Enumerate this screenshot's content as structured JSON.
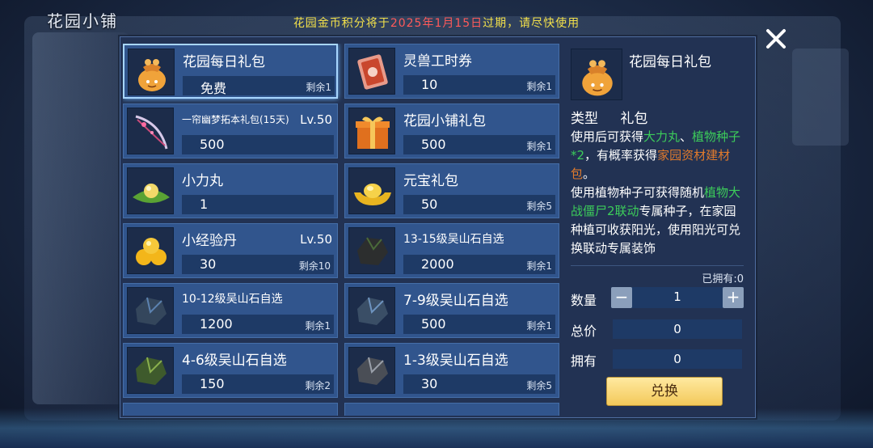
{
  "header": {
    "title": "花园小铺",
    "notice_prefix": "花园金币积分将于",
    "notice_date": "2025年1月15日",
    "notice_suffix": "过期，请尽快使用"
  },
  "items": [
    {
      "name": "花园每日礼包",
      "price": "免费",
      "remain": "剩余1",
      "lv": "",
      "icon": "cloth-bag-icon"
    },
    {
      "name": "灵兽工时券",
      "price": "10",
      "remain": "剩余1",
      "lv": "",
      "icon": "ticket-icon"
    },
    {
      "name": "一帘幽梦拓本礼包(15天)",
      "price": "500",
      "remain": "",
      "lv": "Lv.50",
      "icon": "bow-weapon-icon"
    },
    {
      "name": "花园小铺礼包",
      "price": "500",
      "remain": "剩余1",
      "lv": "",
      "icon": "gift-box-icon"
    },
    {
      "name": "小力丸",
      "price": "1",
      "remain": "",
      "lv": "",
      "icon": "pill-on-leaf-icon"
    },
    {
      "name": "元宝礼包",
      "price": "50",
      "remain": "剩余5",
      "lv": "",
      "icon": "gold-ingot-icon"
    },
    {
      "name": "小经验丹",
      "price": "30",
      "remain": "剩余10",
      "lv": "Lv.50",
      "icon": "golden-pills-icon"
    },
    {
      "name": "13-15级吴山石自选",
      "price": "2000",
      "remain": "剩余1",
      "lv": "",
      "icon": "dark-stone-icon"
    },
    {
      "name": "10-12级吴山石自选",
      "price": "1200",
      "remain": "剩余1",
      "lv": "",
      "icon": "blue-stone-icon"
    },
    {
      "name": "7-9级吴山石自选",
      "price": "500",
      "remain": "剩余1",
      "lv": "",
      "icon": "blue-stone-icon"
    },
    {
      "name": "4-6级吴山石自选",
      "price": "150",
      "remain": "剩余2",
      "lv": "",
      "icon": "green-stone-icon"
    },
    {
      "name": "1-3级吴山石自选",
      "price": "30",
      "remain": "剩余5",
      "lv": "",
      "icon": "grey-stone-icon"
    }
  ],
  "detail": {
    "name": "花园每日礼包",
    "type_label": "类型",
    "type_value": "礼包",
    "desc_1": "使用后可获得",
    "desc_hl1": "大力丸",
    "desc_2": "、",
    "desc_hl2": "植物种子*2",
    "desc_3": "，有概率获得",
    "desc_hl3": "家园资材建材包",
    "desc_4": "。",
    "desc_5": "使用植物种子可获得随机",
    "desc_hl4": "植物大战僵尸2联动",
    "desc_6": "专属种子，在家园种植可收获阳光，使用阳光可兑换联动专属装饰",
    "owned_text": "已拥有:0",
    "qty_label": "数量",
    "qty_value": "1",
    "minus": "−",
    "plus": "+",
    "total_label": "总价",
    "total_value": "0",
    "have_label": "拥有",
    "have_value": "0",
    "exchange_label": "兑换"
  },
  "colors": {
    "notice": "#f3e14a",
    "notice_date": "#ff5a5a",
    "highlight_green": "#3ccc5a",
    "highlight_orange": "#e07a2c",
    "exchange_button": "#f3c95a"
  }
}
